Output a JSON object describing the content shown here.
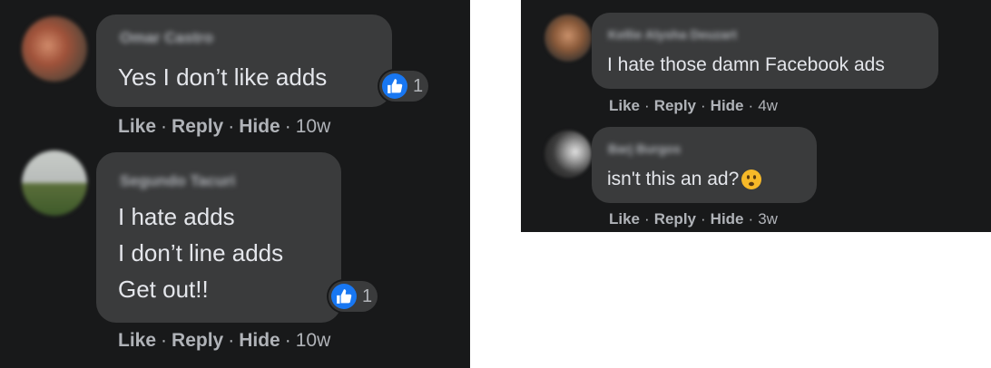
{
  "left_panel": {
    "comments": [
      {
        "author": "Omar Castro",
        "lines": [
          "Yes I don’t like adds"
        ],
        "reaction_count": "1",
        "actions": {
          "like": "Like",
          "reply": "Reply",
          "hide": "Hide",
          "time": "10w"
        }
      },
      {
        "author": "Segundo Tacuri",
        "lines": [
          "I hate adds",
          "I don’t line adds",
          "Get out!!"
        ],
        "reaction_count": "1",
        "actions": {
          "like": "Like",
          "reply": "Reply",
          "hide": "Hide",
          "time": "10w"
        }
      }
    ]
  },
  "right_panel": {
    "comments": [
      {
        "author": "Kellie Alysha Deuzart",
        "lines": [
          "I hate those damn Facebook ads"
        ],
        "actions": {
          "like": "Like",
          "reply": "Reply",
          "hide": "Hide",
          "time": "4w"
        }
      },
      {
        "author": "Barj Burgos",
        "lines": [
          "isn't this an ad?"
        ],
        "emoji": "frowning-face-icon",
        "actions": {
          "like": "Like",
          "reply": "Reply",
          "hide": "Hide",
          "time": "3w"
        }
      }
    ]
  },
  "colors": {
    "background": "#18191a",
    "bubble": "#3a3b3c",
    "text": "#e4e6eb",
    "secondary_text": "#b0b3b8",
    "like_blue": "#1877f2"
  }
}
